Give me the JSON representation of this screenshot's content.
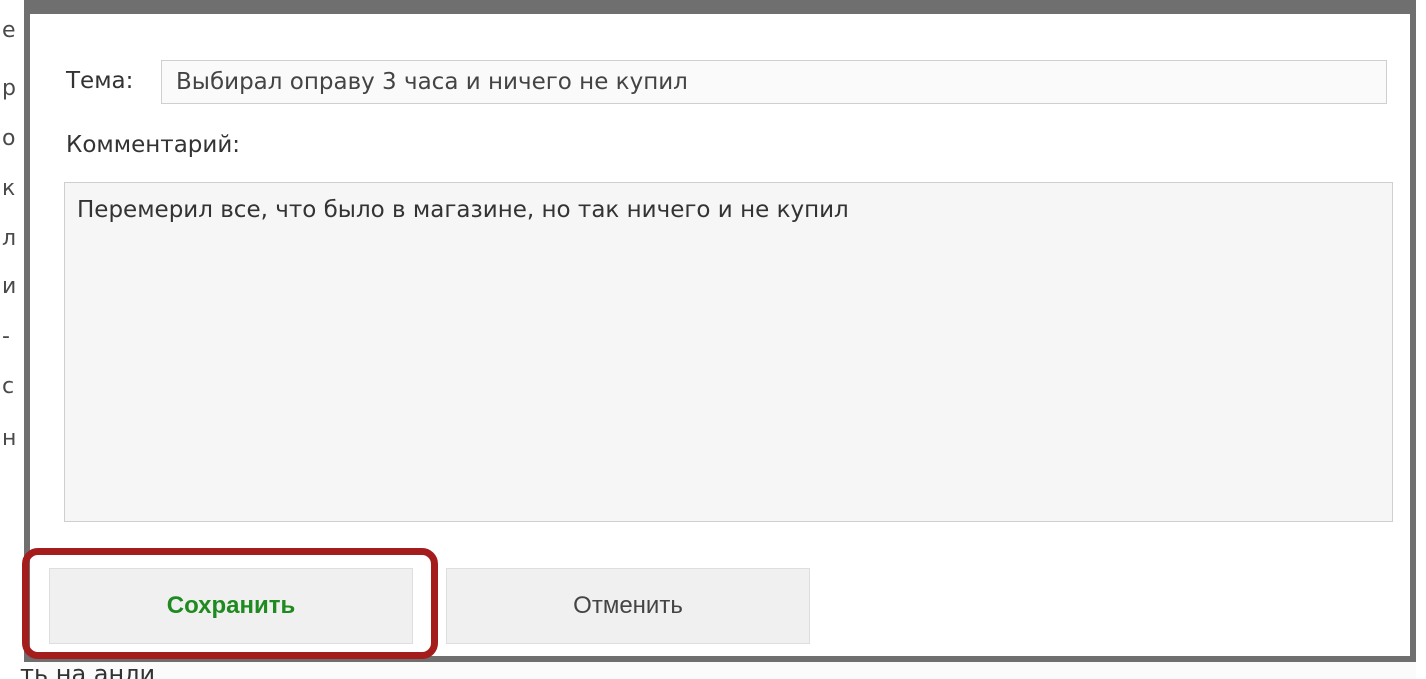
{
  "background": {
    "left_edge_glyphs": [
      "е",
      "р",
      "о",
      "к",
      "л",
      "и",
      "-",
      "с",
      "н"
    ],
    "bottom_text": "ть на анли"
  },
  "dialog": {
    "subject_label": "Тема:",
    "subject_value": "Выбирал оправу 3 часа и ничего не купил",
    "comment_label": "Комментарий:",
    "comment_value": "Перемерил все, что было в магазине, но так ничего и не купил",
    "save_label": "Сохранить",
    "cancel_label": "Отменить"
  },
  "colors": {
    "save_text": "#1f8a1f",
    "highlight_border": "#a51c1c",
    "dialog_border": "#6f6f6f"
  }
}
